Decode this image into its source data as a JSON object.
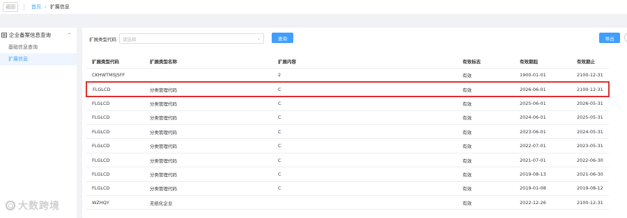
{
  "topbar": {
    "back_label": "返回",
    "breadcrumb": {
      "home": "首页",
      "current": "扩展信息"
    }
  },
  "sidebar": {
    "group_label": "企业备案信息查询",
    "items": [
      {
        "label": "基础信息查询",
        "active": false
      },
      {
        "label": "扩展信息",
        "active": true
      }
    ]
  },
  "filter": {
    "label": "扩展类型代码",
    "placeholder": "请选择",
    "query_label": "查询",
    "export_label": "导出"
  },
  "table": {
    "columns": [
      "扩展类型代码",
      "扩展类型名称",
      "扩展内容",
      "有效标志",
      "有效期起",
      "有效期止"
    ],
    "rows": [
      {
        "code": "CKHWTMSJSFF",
        "name": "",
        "content": "2",
        "flag": "有效",
        "start": "1900-01-01",
        "end": "2100-12-31"
      },
      {
        "code": "FLGLCD",
        "name": "分类管理代码",
        "content": "C",
        "flag": "有效",
        "start": "2026-06-01",
        "end": "2100-12-31"
      },
      {
        "code": "FLGLCD",
        "name": "分类管理代码",
        "content": "C",
        "flag": "有效",
        "start": "2025-06-01",
        "end": "2026-05-31"
      },
      {
        "code": "FLGLCD",
        "name": "分类管理代码",
        "content": "C",
        "flag": "有效",
        "start": "2024-06-01",
        "end": "2025-05-31"
      },
      {
        "code": "FLGLCD",
        "name": "分类管理代码",
        "content": "C",
        "flag": "有效",
        "start": "2023-06-01",
        "end": "2024-05-31"
      },
      {
        "code": "FLGLCD",
        "name": "分类管理代码",
        "content": "C",
        "flag": "有效",
        "start": "2022-07-01",
        "end": "2023-05-31"
      },
      {
        "code": "FLGLCD",
        "name": "分类管理代码",
        "content": "C",
        "flag": "有效",
        "start": "2021-07-01",
        "end": "2022-06-30"
      },
      {
        "code": "FLGLCD",
        "name": "分类管理代码",
        "content": "C",
        "flag": "有效",
        "start": "2019-08-13",
        "end": "2021-06-30"
      },
      {
        "code": "FLGLCD",
        "name": "分类管理代码",
        "content": "C",
        "flag": "有效",
        "start": "2019-01-08",
        "end": "2019-08-12"
      },
      {
        "code": "WZHQY",
        "name": "无纸化企业",
        "content": "",
        "flag": "有效",
        "start": "2022-12-26",
        "end": "2100-12-31"
      }
    ],
    "highlighted_row": 1,
    "highlight_color": "#e02c2c"
  },
  "watermark": {
    "text": "大数跨境"
  },
  "colors": {
    "primary": "#409eff",
    "active_bg": "#eef5ff"
  }
}
